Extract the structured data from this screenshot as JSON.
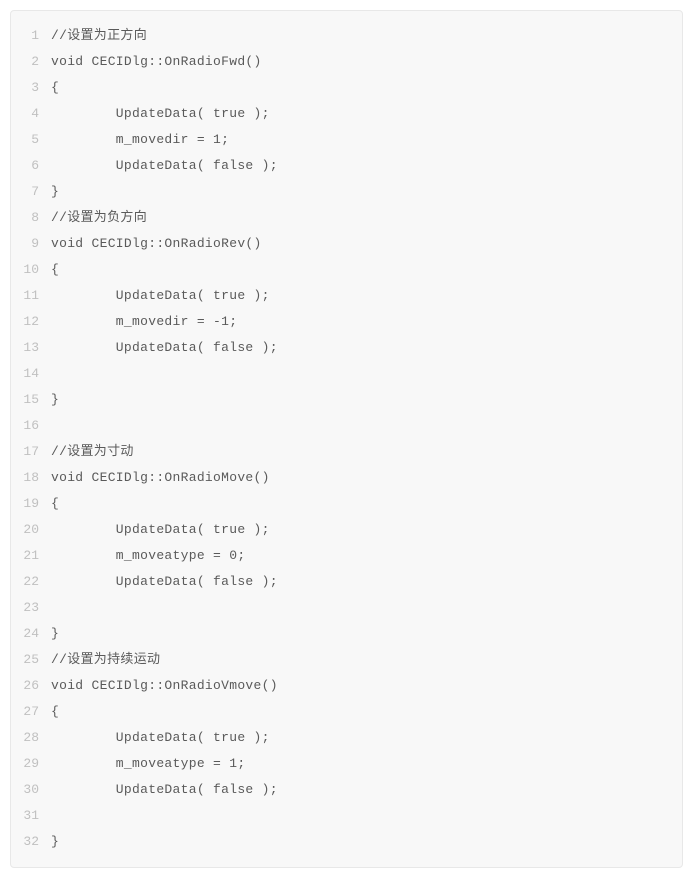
{
  "code": {
    "lines": [
      {
        "num": "1",
        "text": "//设置为正方向"
      },
      {
        "num": "2",
        "text": "void CECIDlg::OnRadioFwd()"
      },
      {
        "num": "3",
        "text": "{"
      },
      {
        "num": "4",
        "text": "        UpdateData( true );"
      },
      {
        "num": "5",
        "text": "        m_movedir = 1;"
      },
      {
        "num": "6",
        "text": "        UpdateData( false );"
      },
      {
        "num": "7",
        "text": "}"
      },
      {
        "num": "8",
        "text": "//设置为负方向"
      },
      {
        "num": "9",
        "text": "void CECIDlg::OnRadioRev()"
      },
      {
        "num": "10",
        "text": "{"
      },
      {
        "num": "11",
        "text": "        UpdateData( true );"
      },
      {
        "num": "12",
        "text": "        m_movedir = -1;"
      },
      {
        "num": "13",
        "text": "        UpdateData( false );"
      },
      {
        "num": "14",
        "text": ""
      },
      {
        "num": "15",
        "text": "}"
      },
      {
        "num": "16",
        "text": ""
      },
      {
        "num": "17",
        "text": "//设置为寸动"
      },
      {
        "num": "18",
        "text": "void CECIDlg::OnRadioMove()"
      },
      {
        "num": "19",
        "text": "{"
      },
      {
        "num": "20",
        "text": "        UpdateData( true );"
      },
      {
        "num": "21",
        "text": "        m_moveatype = 0;"
      },
      {
        "num": "22",
        "text": "        UpdateData( false );"
      },
      {
        "num": "23",
        "text": ""
      },
      {
        "num": "24",
        "text": "}"
      },
      {
        "num": "25",
        "text": "//设置为持续运动"
      },
      {
        "num": "26",
        "text": "void CECIDlg::OnRadioVmove()"
      },
      {
        "num": "27",
        "text": "{"
      },
      {
        "num": "28",
        "text": "        UpdateData( true );"
      },
      {
        "num": "29",
        "text": "        m_moveatype = 1;"
      },
      {
        "num": "30",
        "text": "        UpdateData( false );"
      },
      {
        "num": "31",
        "text": ""
      },
      {
        "num": "32",
        "text": "}"
      }
    ]
  }
}
